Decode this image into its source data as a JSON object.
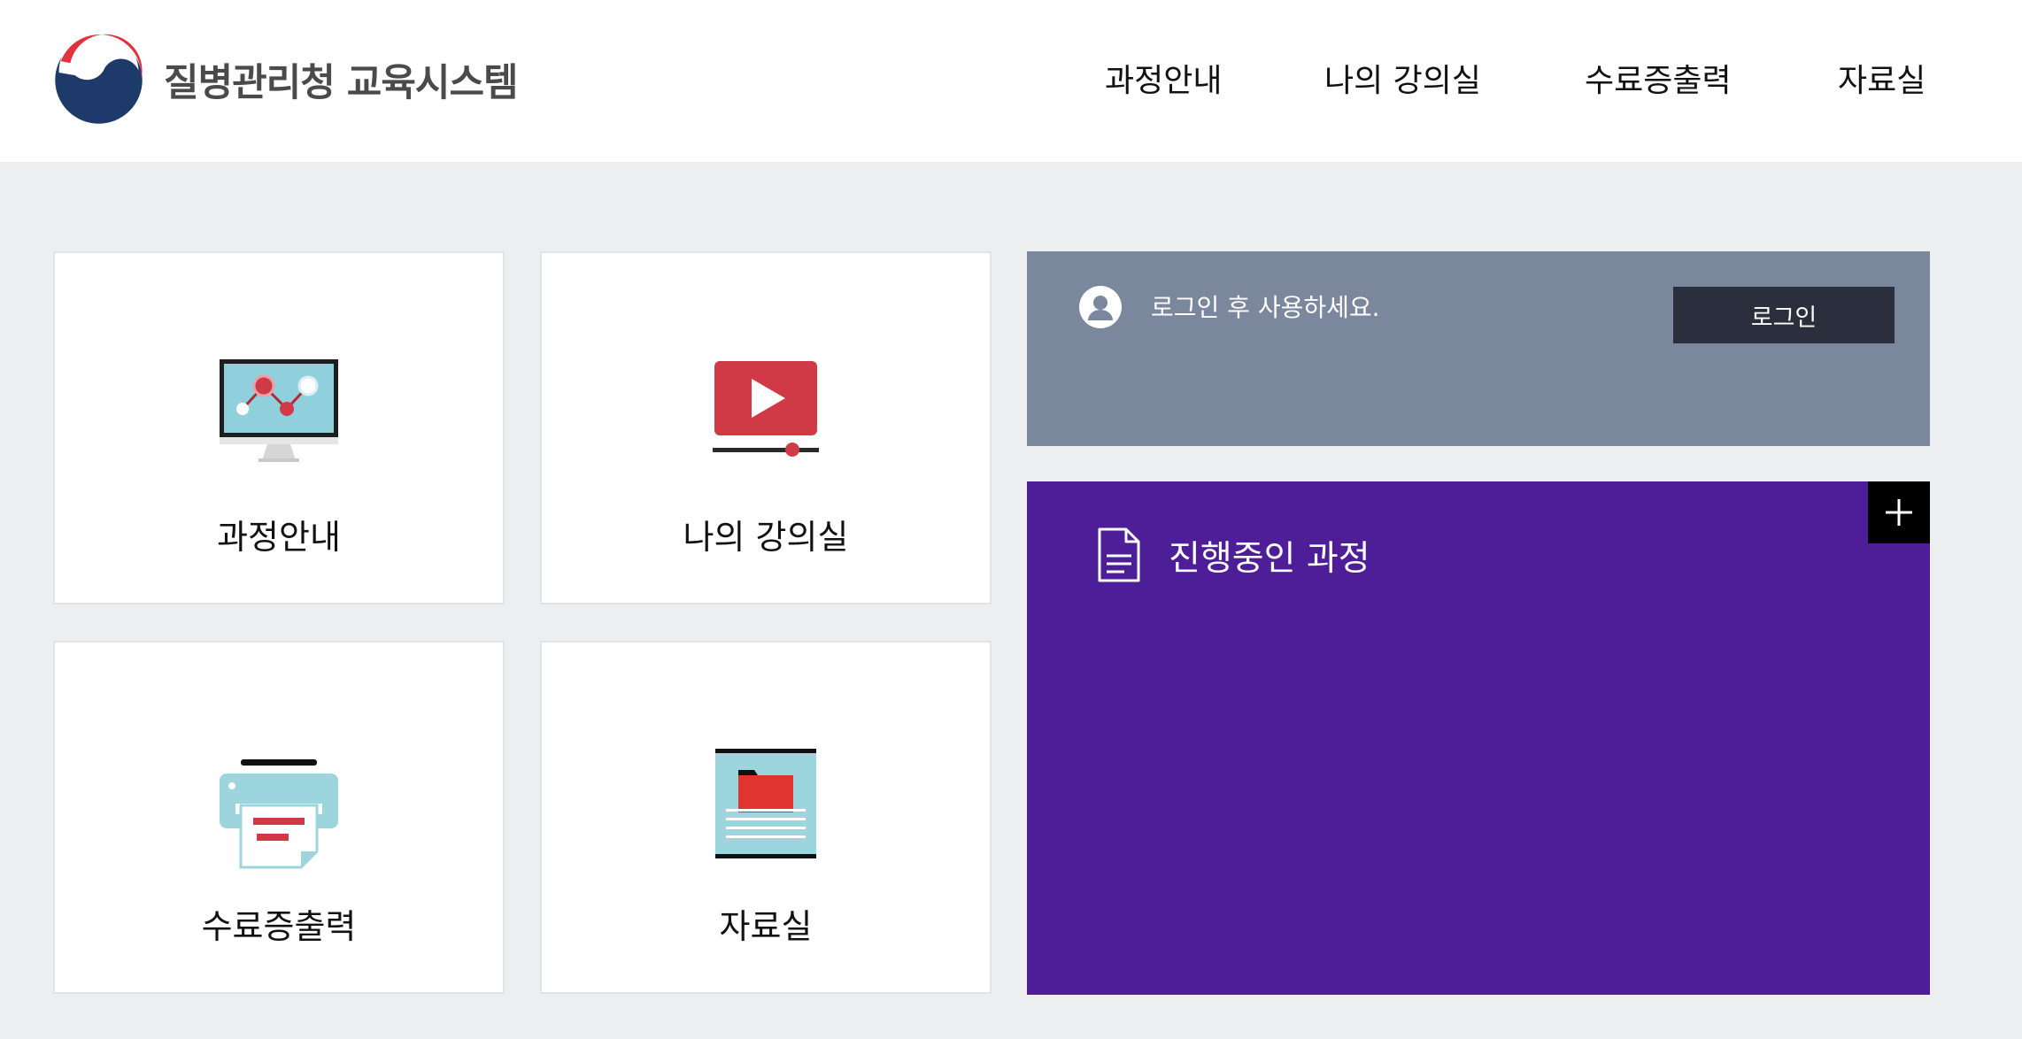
{
  "header": {
    "logo_text": "질병관리청 교육시스템",
    "nav": [
      "과정안내",
      "나의 강의실",
      "수료증출력",
      "자료실"
    ]
  },
  "tiles": [
    {
      "label": "과정안내",
      "icon": "monitor-chart-icon"
    },
    {
      "label": "나의 강의실",
      "icon": "video-play-icon"
    },
    {
      "label": "수료증출력",
      "icon": "printer-icon"
    },
    {
      "label": "자료실",
      "icon": "folder-document-icon"
    }
  ],
  "login": {
    "message": "로그인 후 사용하세요.",
    "button_label": "로그인"
  },
  "course": {
    "title": "진행중인 과정",
    "more_icon": "plus-icon"
  },
  "colors": {
    "page_bg": "#edeef0",
    "login_panel": "#7a879c",
    "login_button": "#2b2f3d",
    "course_panel": "#4e1e99",
    "accent_red": "#cf3a46",
    "logo_blue": "#1d3a6b"
  }
}
